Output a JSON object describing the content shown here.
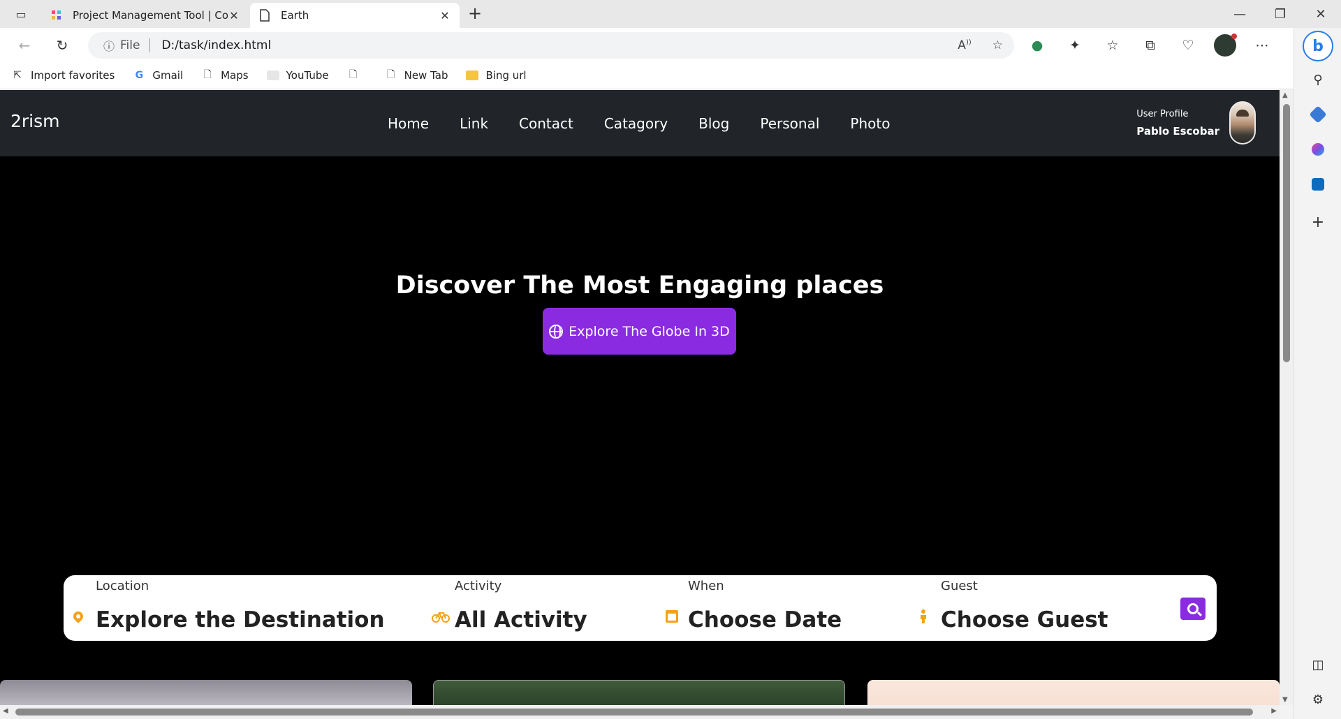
{
  "browser": {
    "tabs": [
      {
        "title": "Project Management Tool | Code",
        "active": false
      },
      {
        "title": "Earth",
        "active": true
      }
    ],
    "address": {
      "scheme": "File",
      "url": "D:/task/index.html"
    },
    "bookmarks": [
      "Import favorites",
      "Gmail",
      "Maps",
      "YouTube",
      "",
      "New Tab",
      "Bing url"
    ]
  },
  "site": {
    "brand": "2rism",
    "nav": [
      "Home",
      "Link",
      "Contact",
      "Catagory",
      "Blog",
      "Personal",
      "Photo"
    ],
    "profile": {
      "label": "User Profile",
      "name": "Pablo Escobar"
    },
    "hero": {
      "title": "Discover The Most Engaging places",
      "button": "Explore The Globe In 3D"
    },
    "search": {
      "location": {
        "label": "Location",
        "value": "Explore the Destination",
        "icon": "map-pin-icon"
      },
      "activity": {
        "label": "Activity",
        "value": "All Activity",
        "icon": "bicycle-icon"
      },
      "when": {
        "label": "When",
        "value": "Choose Date",
        "icon": "calendar-icon"
      },
      "guest": {
        "label": "Guest",
        "value": "Choose Guest",
        "icon": "person-icon"
      }
    }
  },
  "colors": {
    "accent": "#8a2be2",
    "icon_orange": "#f7a01c",
    "navbar": "#212529"
  }
}
